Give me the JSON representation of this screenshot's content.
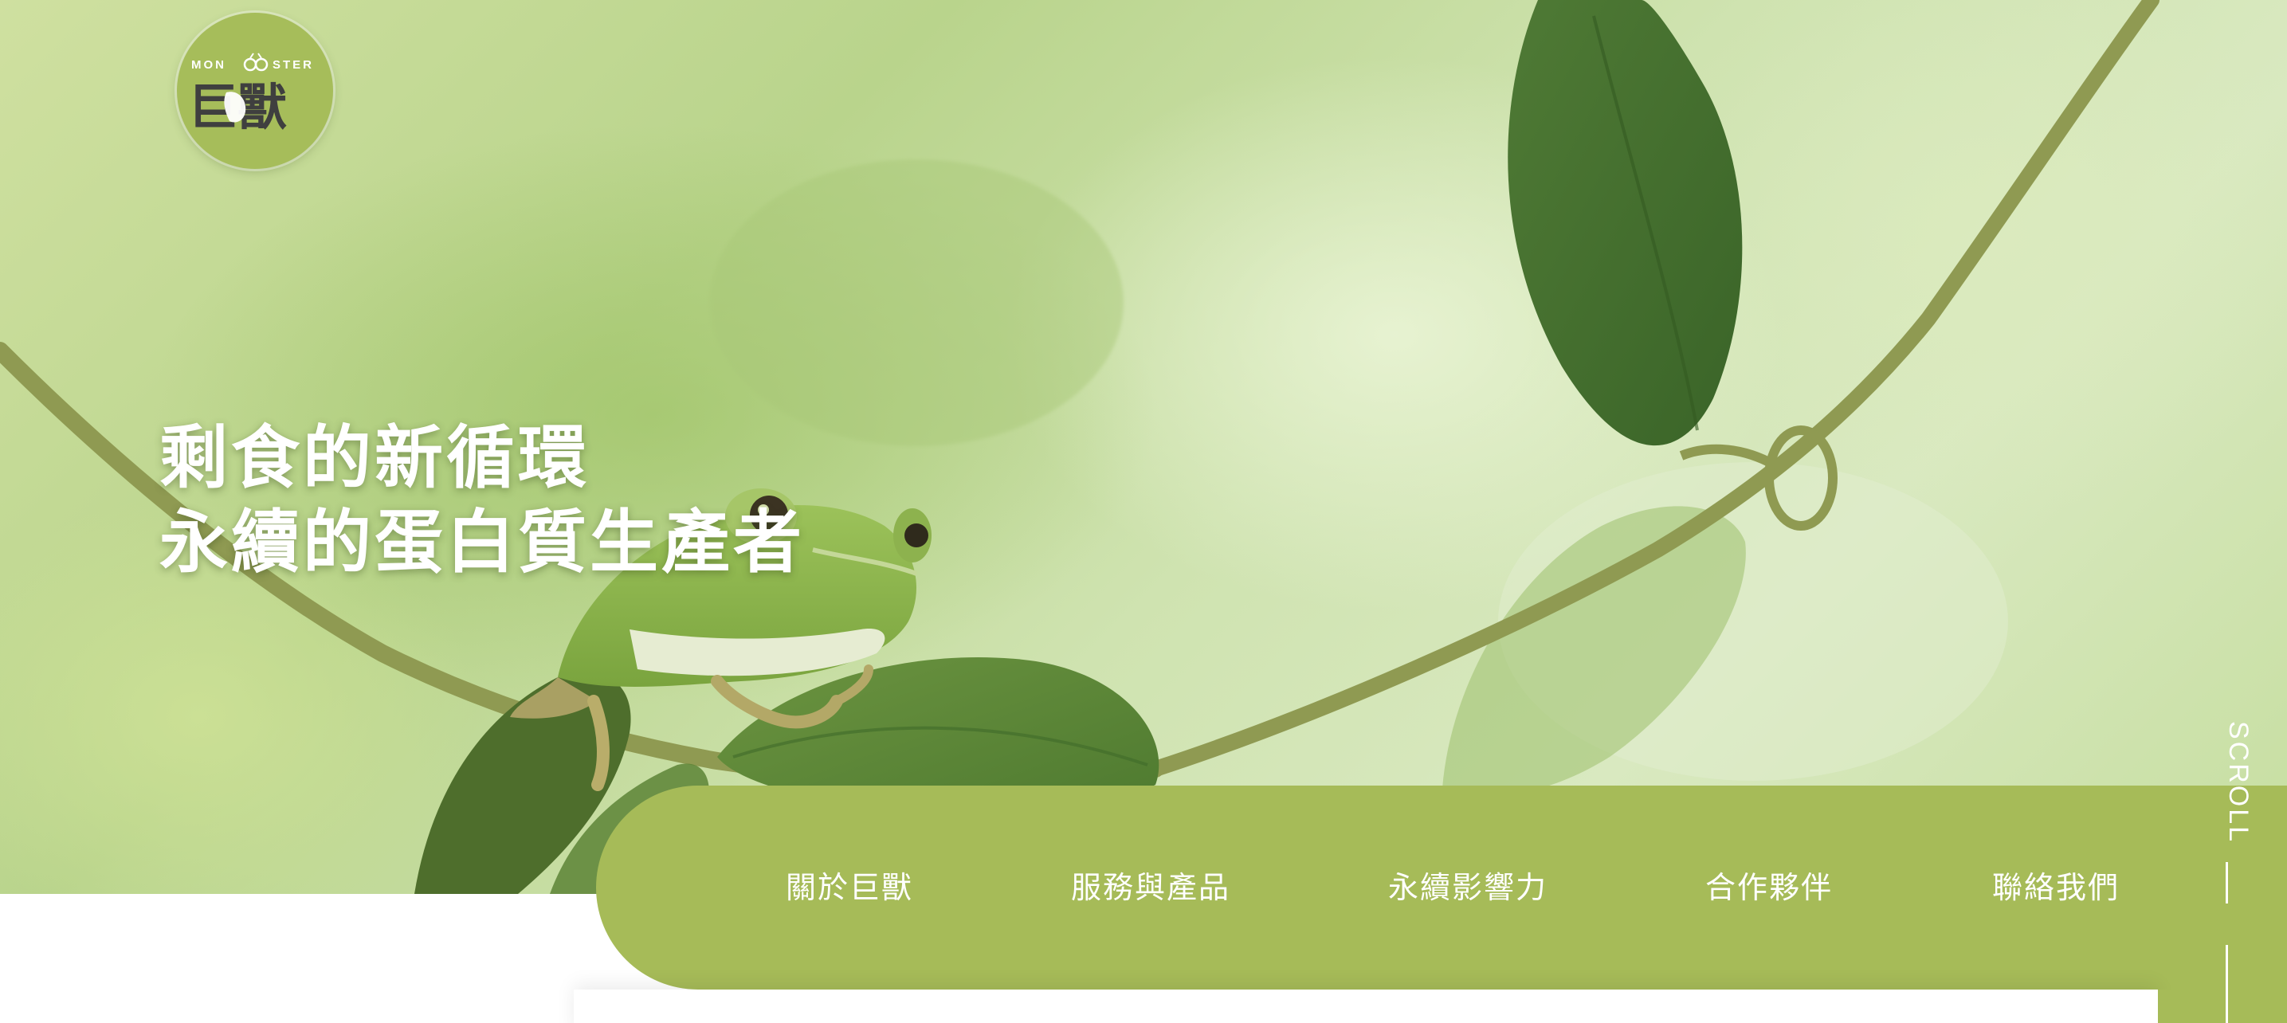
{
  "logo": {
    "wordmark": "MONSTER",
    "name": "巨獸",
    "icon": "monster-logo-icon"
  },
  "hero": {
    "title_line1": "剩食的新循環",
    "title_line2": "永續的蛋白質生產者"
  },
  "nav": {
    "items": [
      {
        "label": "關於巨獸"
      },
      {
        "label": "服務與產品"
      },
      {
        "label": "永續影響力"
      },
      {
        "label": "合作夥伴"
      },
      {
        "label": "聯絡我們"
      }
    ]
  },
  "scroll": {
    "label": "SCROLL"
  },
  "colors": {
    "accent": "#a6bb58",
    "text_on_accent": "#ffffff"
  }
}
